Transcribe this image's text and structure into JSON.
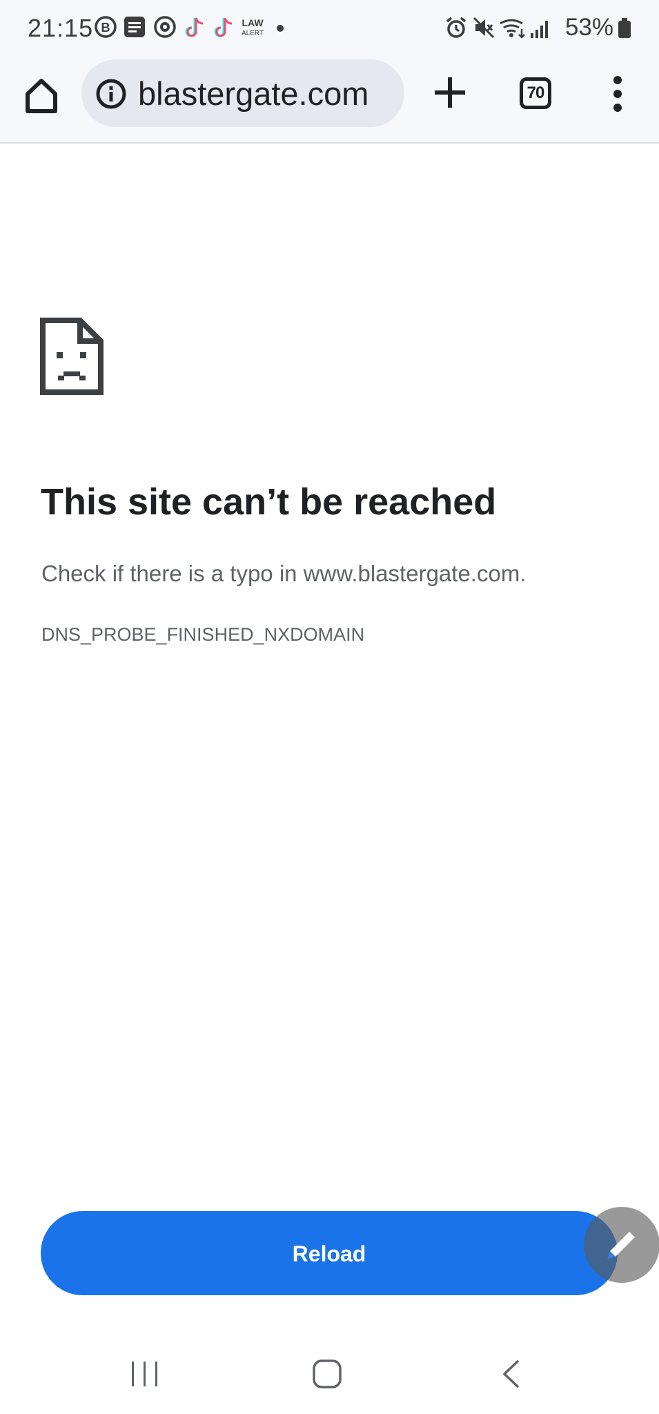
{
  "status_bar": {
    "time": "21:15",
    "notification_icons": [
      "b-circle-icon",
      "message-icon",
      "app-badge-icon",
      "tiktok-icon",
      "tiktok-icon",
      "law-alert-icon",
      "dot-icon"
    ],
    "law_alert_line1": "LAW",
    "law_alert_line2": "ALERT",
    "b_letter": "B",
    "system_icons": [
      "alarm-icon",
      "mute-icon",
      "wifi-icon",
      "signal-icon",
      "battery-icon"
    ],
    "battery_percent": "53%"
  },
  "toolbar": {
    "url": "blastergate.com",
    "tab_count": "70"
  },
  "error": {
    "title": "This site can’t be reached",
    "description": "Check if there is a typo in www.blastergate.com.",
    "code": "DNS_PROBE_FINISHED_NXDOMAIN"
  },
  "actions": {
    "reload_label": "Reload"
  },
  "colors": {
    "primary_blue": "#1a73e8",
    "toolbar_bg": "#f7f8fb",
    "omnibox_bg": "#e5e8ee",
    "text_dark": "#202124",
    "text_secondary": "#5f6368"
  }
}
